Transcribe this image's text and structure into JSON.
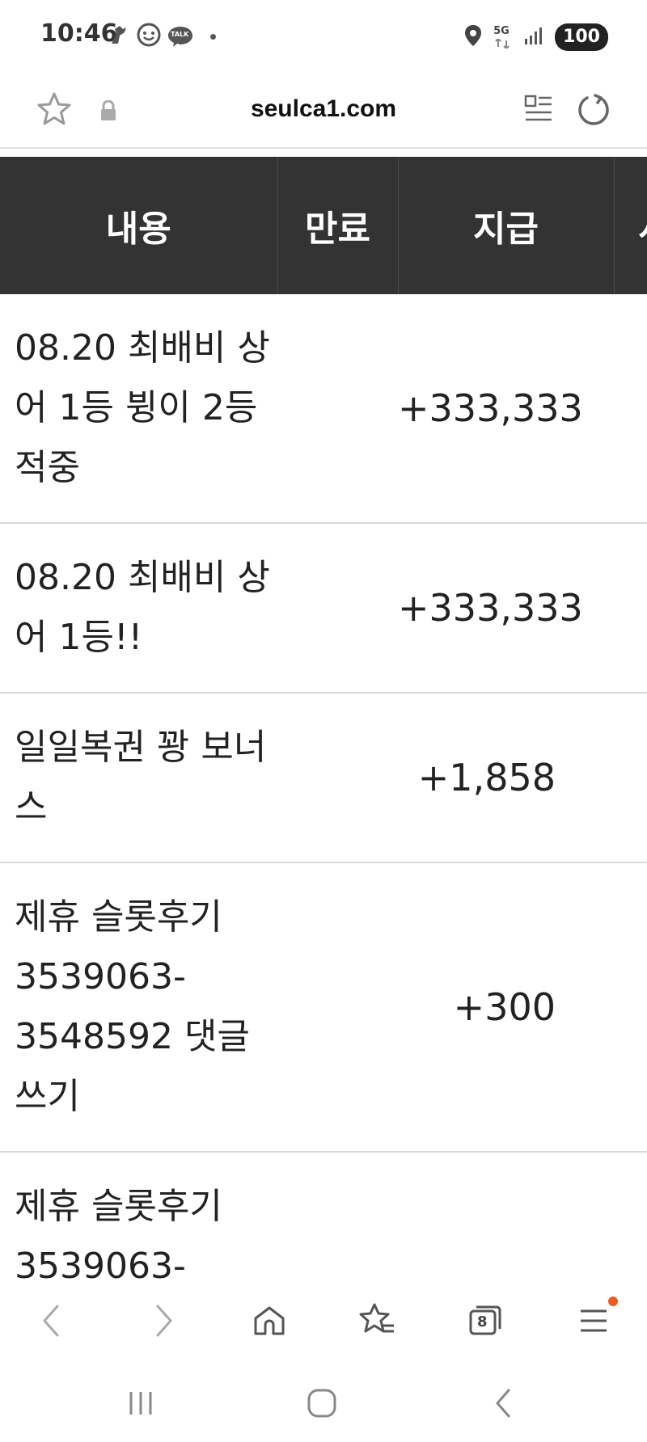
{
  "status_bar": {
    "time": "10:46",
    "talk_label": "TALK",
    "network": "5G",
    "battery": "100"
  },
  "browser": {
    "url": "seulca1.com"
  },
  "table": {
    "headers": [
      "내용",
      "만료",
      "지급",
      "사"
    ],
    "rows": [
      {
        "content": "08.20 최배비 상어 1등 뷩이 2등 적중",
        "expiry": "",
        "amount": "+333,333"
      },
      {
        "content": "08.20 최배비 상어 1등!!",
        "expiry": "",
        "amount": "+333,333"
      },
      {
        "content": "일일복권 꽝 보너스",
        "expiry": "",
        "amount": "+1,858"
      },
      {
        "content": "제휴 슬롯후기 3539063-3548592 댓글쓰기",
        "expiry": "",
        "amount": "+300"
      },
      {
        "content": "제휴 슬롯후기 3539063-",
        "expiry": "",
        "amount": ""
      }
    ]
  },
  "bottom_bar": {
    "tabs_count": "8"
  },
  "colors": {
    "header_bg": "#333333",
    "notification_dot": "#f05a22"
  }
}
